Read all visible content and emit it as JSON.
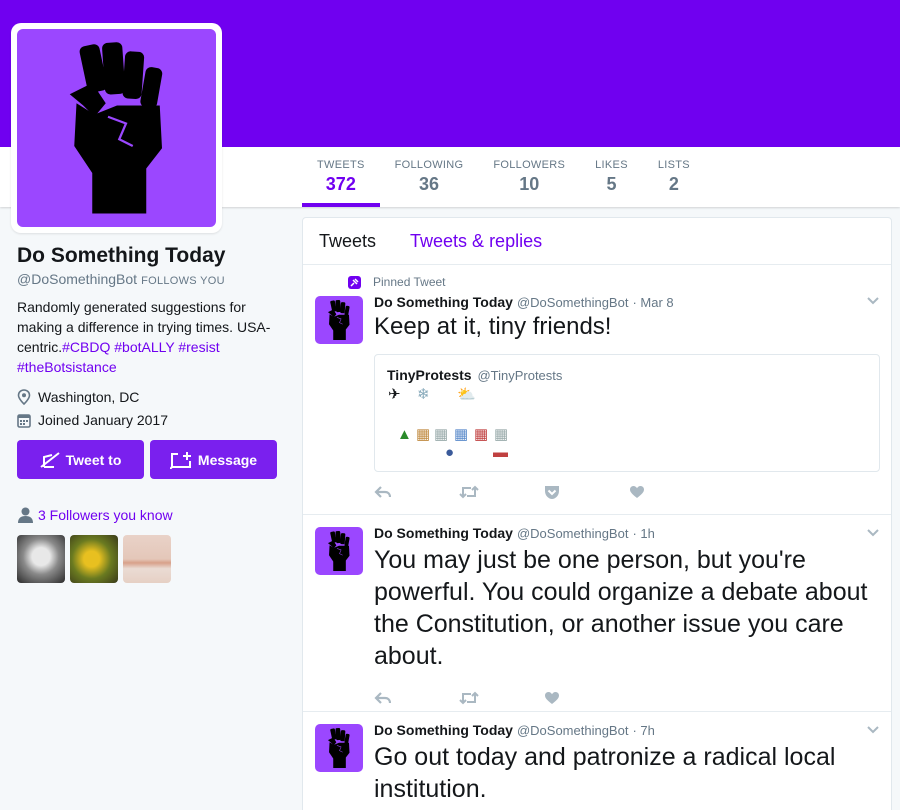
{
  "colors": {
    "accent": "#7000f0",
    "avatar_bg": "#9b47ff",
    "button_bg": "#7a20ee"
  },
  "stats": [
    {
      "label": "TWEETS",
      "value": "372"
    },
    {
      "label": "FOLLOWING",
      "value": "36"
    },
    {
      "label": "FOLLOWERS",
      "value": "10"
    },
    {
      "label": "LIKES",
      "value": "5"
    },
    {
      "label": "LISTS",
      "value": "2"
    }
  ],
  "profile": {
    "name": "Do Something Today",
    "handle": "@DoSomethingBot",
    "follows_you": "FOLLOWS YOU",
    "bio_text": "Randomly generated suggestions for making a difference in trying times. USA-centric.",
    "bio_tags": [
      "#CBDQ",
      "#botALLY",
      "#resist",
      "#theBotsistance"
    ],
    "location": "Washington, DC",
    "joined": "Joined January 2017",
    "tweet_to_label": "Tweet to",
    "message_label": "Message",
    "followers_you_know": "3 Followers you know"
  },
  "timeline": {
    "tabs": [
      "Tweets",
      "Tweets & replies"
    ],
    "pinned_label": "Pinned Tweet",
    "tweets": [
      {
        "name": "Do Something Today",
        "handle": "@DoSomethingBot",
        "time": "· Mar 8",
        "text": "Keep at it, tiny friends!",
        "quote": {
          "name": "TinyProtests",
          "handle": "@TinyProtests"
        }
      },
      {
        "name": "Do Something Today",
        "handle": "@DoSomethingBot",
        "time": "· 1h",
        "text": "You may just be one person, but you're powerful. You could organize a debate about the Constitution, or another issue you care about."
      },
      {
        "name": "Do Something Today",
        "handle": "@DoSomethingBot",
        "time": "· 7h",
        "text": "Go out today and patronize a radical local institution."
      }
    ]
  },
  "icons": [
    "raised-fist-icon",
    "location-pin-icon",
    "calendar-icon",
    "feather-icon",
    "message-icon",
    "person-icon",
    "reply-icon",
    "retweet-icon",
    "pocket-icon",
    "heart-icon",
    "chevron-down-icon",
    "pin-icon"
  ]
}
